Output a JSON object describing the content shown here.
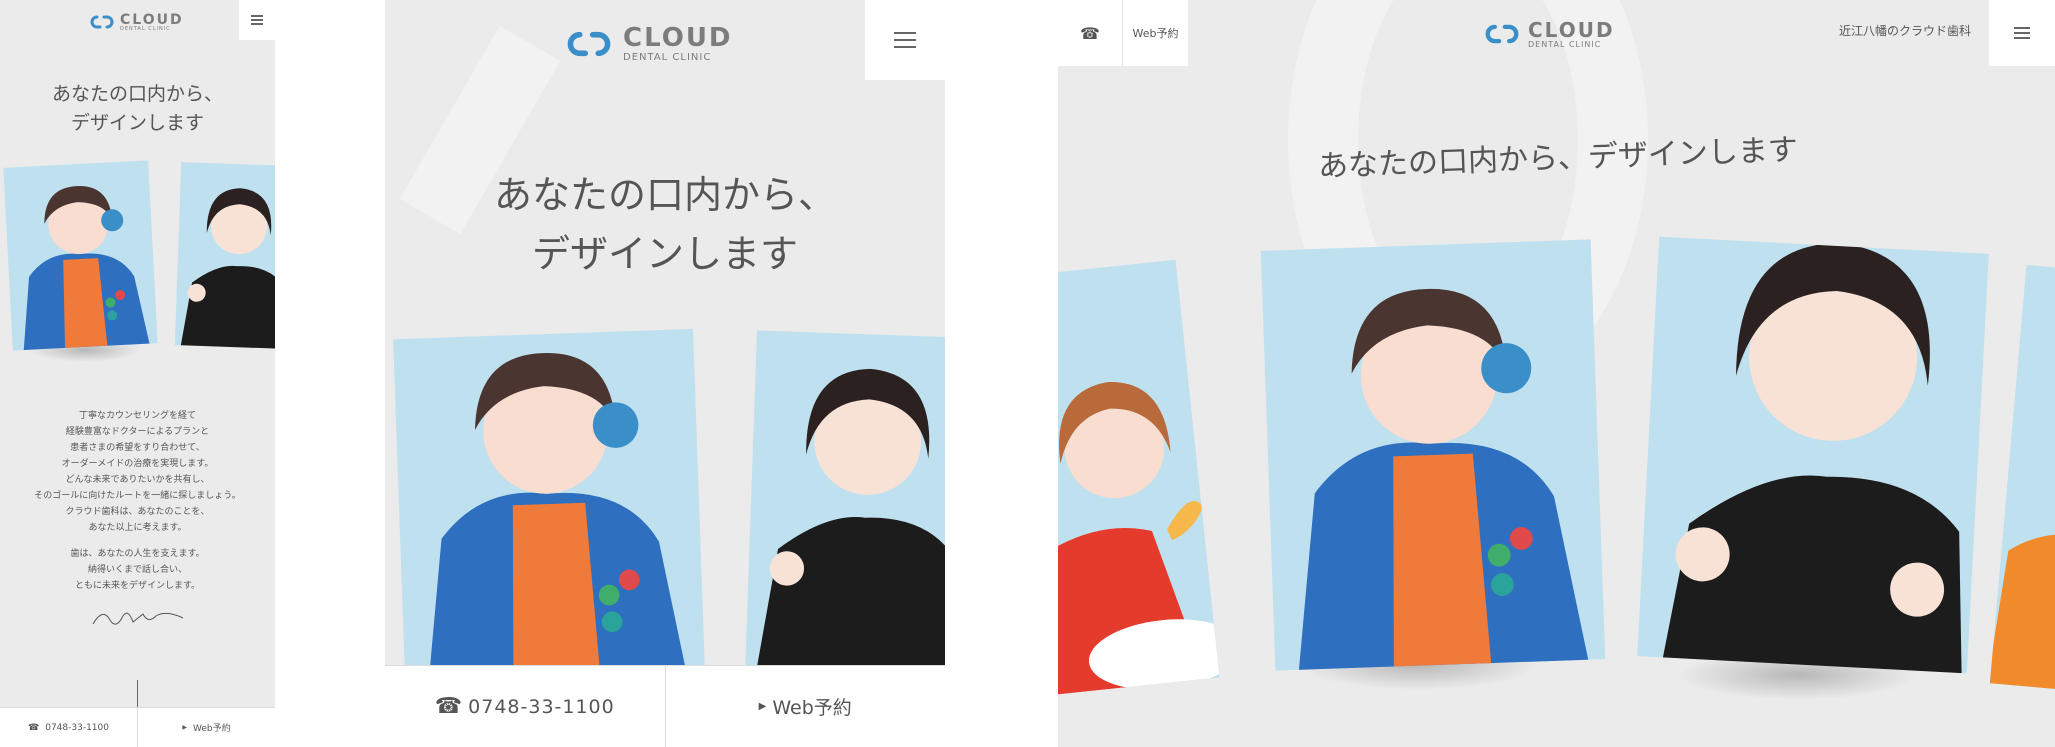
{
  "brand": {
    "logo_main": "CLOUD",
    "logo_sub": "DENTAL CLINIC",
    "color_blue": "#3a8fc9",
    "color_gray": "#7c7c7c"
  },
  "headline": {
    "line1": "あなたの口内から、",
    "line2": "デザインします",
    "full": "あなたの口内から、デザインします"
  },
  "intro": {
    "lines": [
      "丁寧なカウンセリングを経て",
      "経験豊富なドクターによるプランと",
      "患者さまの希望をすり合わせて、",
      "オーダーメイドの治療を実現します。",
      "どんな未来でありたいかを共有し、",
      "そのゴールに向けたルートを一緒に探しましょう。",
      "クラウド歯科は、あなたのことを、",
      "あなた以上に考えます。"
    ],
    "lines2": [
      "歯は、あなたの人生を支えます。",
      "納得いくまで話し合い、",
      "ともに未来をデザインします。"
    ]
  },
  "contact": {
    "phone": "0748-33-1100",
    "web_label": "Web予約"
  },
  "desktop": {
    "tagline": "近江八幡のクラウド歯科"
  },
  "icons": {
    "menu": "hamburger-icon",
    "phone": "phone-icon",
    "arrow": "triangle-right-icon"
  }
}
